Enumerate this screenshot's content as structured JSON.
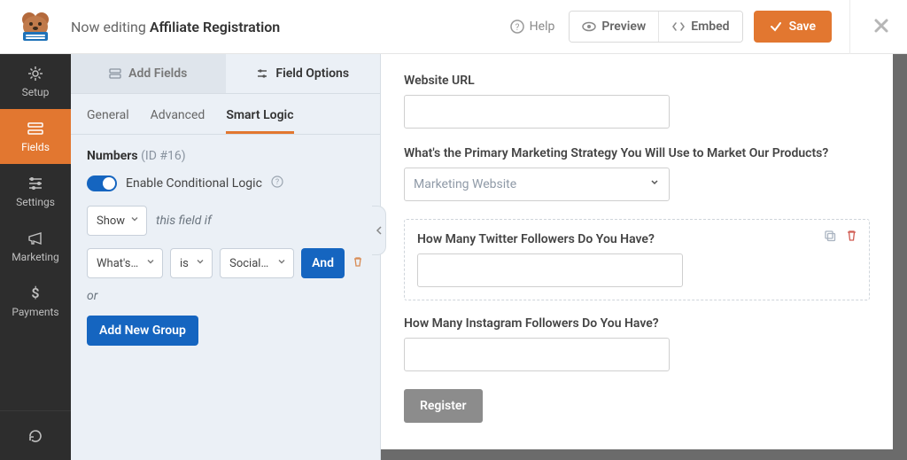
{
  "topbar": {
    "now_editing": "Now editing",
    "form_name": "Affiliate Registration",
    "help": "Help",
    "preview": "Preview",
    "embed": "Embed",
    "save": "Save"
  },
  "leftnav": {
    "items": [
      {
        "id": "setup",
        "label": "Setup"
      },
      {
        "id": "fields",
        "label": "Fields"
      },
      {
        "id": "settings",
        "label": "Settings"
      },
      {
        "id": "marketing",
        "label": "Marketing"
      },
      {
        "id": "payments",
        "label": "Payments"
      }
    ]
  },
  "sidepanel": {
    "tabs": {
      "add_fields": "Add Fields",
      "field_options": "Field Options"
    },
    "subtabs": {
      "general": "General",
      "advanced": "Advanced",
      "smart_logic": "Smart Logic"
    },
    "field_label": "Numbers",
    "field_id": "(ID #16)",
    "toggle_label": "Enable Conditional Logic",
    "rule": {
      "action": "Show",
      "trailer": "this field if"
    },
    "condition": {
      "field": "What's t…",
      "op": "is",
      "value": "Social …",
      "and": "And"
    },
    "or_label": "or",
    "add_group": "Add New Group"
  },
  "canvas": {
    "website_url_label": "Website URL",
    "strategy_label": "What's the Primary Marketing Strategy You Will Use to Market Our Products?",
    "strategy_selected": "Marketing Website",
    "twitter_label": "How Many Twitter Followers Do You Have?",
    "instagram_label": "How Many Instagram Followers Do You Have?",
    "submit": "Register"
  }
}
